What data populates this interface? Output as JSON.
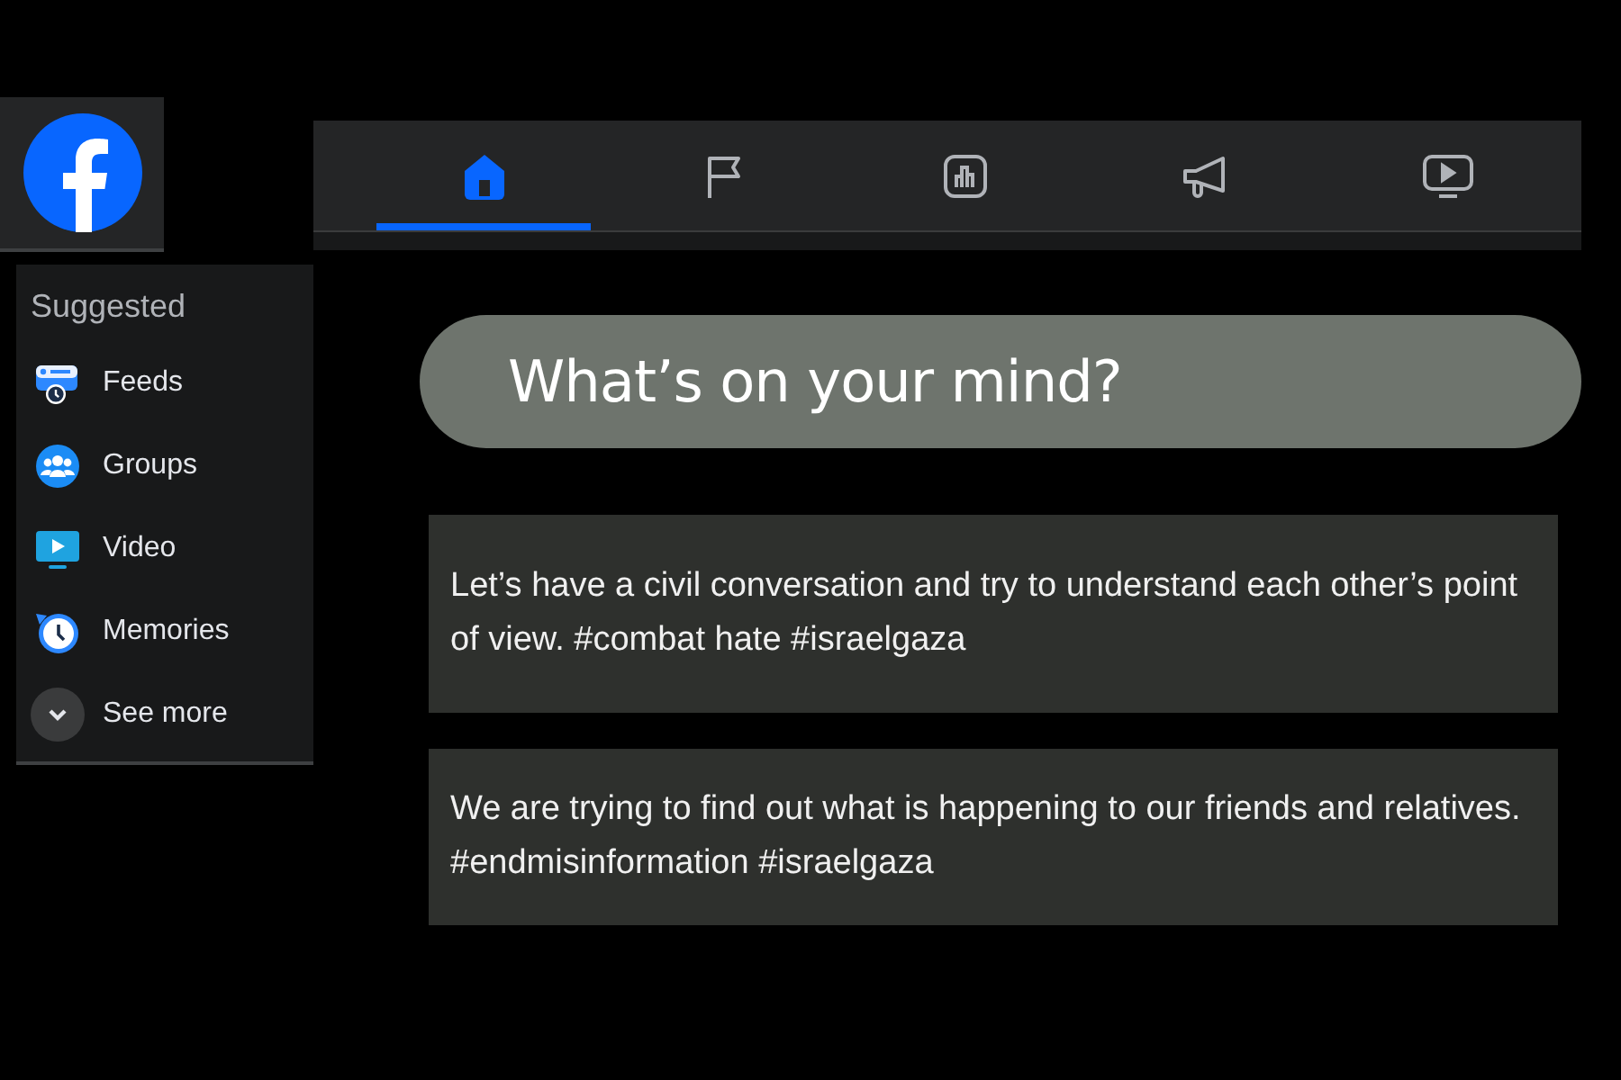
{
  "sidebar": {
    "heading": "Suggested",
    "items": [
      {
        "kind": "feeds",
        "label": "Feeds"
      },
      {
        "kind": "groups",
        "label": "Groups"
      },
      {
        "kind": "video",
        "label": "Video"
      },
      {
        "kind": "memories",
        "label": "Memories"
      },
      {
        "kind": "more",
        "label": "See more"
      }
    ]
  },
  "tabs": [
    {
      "kind": "home",
      "selected": true
    },
    {
      "kind": "flag",
      "selected": false
    },
    {
      "kind": "chart",
      "selected": false
    },
    {
      "kind": "megaphone",
      "selected": false
    },
    {
      "kind": "play",
      "selected": false
    }
  ],
  "composer": {
    "placeholder": "What’s on your mind?"
  },
  "posts": [
    {
      "text": "Let’s have a civil conversation and try to understand each other’s point of view.  #combat hate #israelgaza"
    },
    {
      "text": "We are trying to find out what is happening to our friends and relatives. #endmisinformation #israelgaza"
    }
  ]
}
